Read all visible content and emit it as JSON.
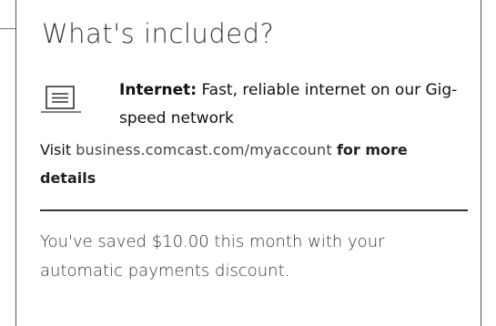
{
  "section": {
    "title": "What's included?"
  },
  "item": {
    "icon": "laptop-icon",
    "label": "Internet:",
    "description": "Fast, reliable internet on our Gig-speed network"
  },
  "visit": {
    "prefix": "Visit",
    "link": "business.comcast.com/myaccount",
    "suffix": "for more details"
  },
  "savings": {
    "text": "You've saved $10.00 this month with your automatic payments discount."
  }
}
